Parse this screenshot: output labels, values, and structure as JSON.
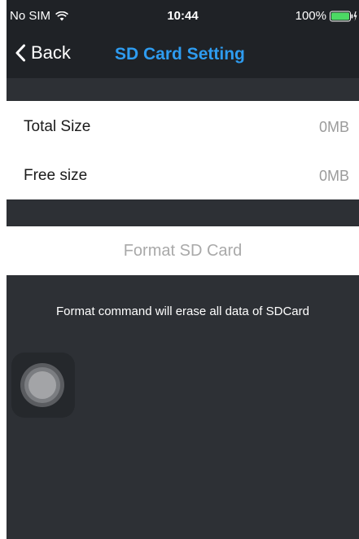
{
  "status_bar": {
    "carrier": "No SIM",
    "time": "10:44",
    "battery": "100%",
    "icons": [
      "wifi-icon",
      "battery-icon",
      "charging-bolt-icon"
    ]
  },
  "nav": {
    "back_label": "Back",
    "title": "SD Card Setting",
    "title_color": "#2e9cf0"
  },
  "info": {
    "rows": [
      {
        "label": "Total Size",
        "value": "0MB"
      },
      {
        "label": "Free size",
        "value": "0MB"
      }
    ]
  },
  "format": {
    "button_label": "Format SD Card",
    "hint": "Format command will erase all data of SDCard"
  },
  "colors": {
    "background": "#2d3035",
    "bar": "#1f2226",
    "battery": "#4cd964"
  }
}
